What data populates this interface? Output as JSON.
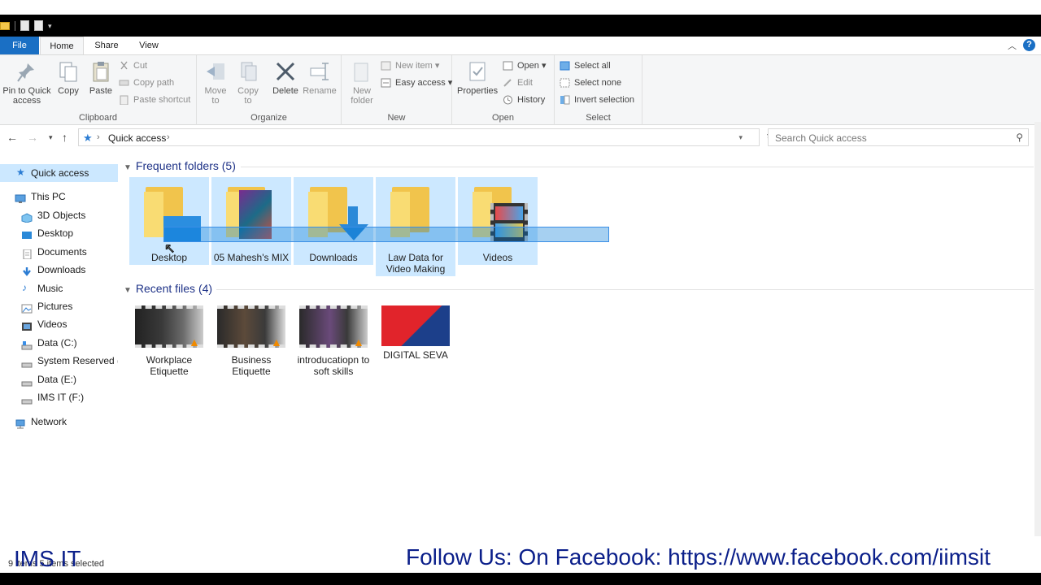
{
  "tabs": {
    "file": "File",
    "home": "Home",
    "share": "Share",
    "view": "View",
    "help": "?"
  },
  "ribbon": {
    "clipboard": {
      "label": "Clipboard",
      "pin": "Pin to Quick access",
      "copy": "Copy",
      "paste": "Paste",
      "cut": "Cut",
      "copy_path": "Copy path",
      "paste_shortcut": "Paste shortcut"
    },
    "organize": {
      "label": "Organize",
      "move_to": "Move to",
      "copy_to": "Copy to",
      "delete": "Delete",
      "rename": "Rename"
    },
    "new": {
      "label": "New",
      "new_folder": "New folder",
      "new_item": "New item",
      "easy_access": "Easy access"
    },
    "open": {
      "label": "Open",
      "properties": "Properties",
      "open": "Open",
      "edit": "Edit",
      "history": "History"
    },
    "select": {
      "label": "Select",
      "select_all": "Select all",
      "select_none": "Select none",
      "invert": "Invert selection"
    }
  },
  "address": {
    "path": "Quick access",
    "search_placeholder": "Search Quick access"
  },
  "nav": [
    {
      "label": "Quick access",
      "icon": "star-icon",
      "selected": true
    },
    {
      "label": "This PC",
      "icon": "pc-icon"
    },
    {
      "label": "3D Objects",
      "icon": "cube-icon"
    },
    {
      "label": "Desktop",
      "icon": "desktop-icon"
    },
    {
      "label": "Documents",
      "icon": "document-icon"
    },
    {
      "label": "Downloads",
      "icon": "download-icon"
    },
    {
      "label": "Music",
      "icon": "music-icon"
    },
    {
      "label": "Pictures",
      "icon": "pictures-icon"
    },
    {
      "label": "Videos",
      "icon": "videos-icon"
    },
    {
      "label": "Data (C:)",
      "icon": "drive-icon"
    },
    {
      "label": "System Reserved (D",
      "icon": "drive-icon"
    },
    {
      "label": "Data (E:)",
      "icon": "drive-icon"
    },
    {
      "label": "IMS IT (F:)",
      "icon": "drive-icon"
    },
    {
      "label": "Network",
      "icon": "network-icon"
    }
  ],
  "frequent": {
    "header": "Frequent folders (5)",
    "items": [
      {
        "label": "Desktop"
      },
      {
        "label": "05 Mahesh's MIX"
      },
      {
        "label": "Downloads"
      },
      {
        "label": "Law Data for Video Making"
      },
      {
        "label": "Videos"
      }
    ]
  },
  "recent": {
    "header": "Recent files (4)",
    "items": [
      {
        "label": "Workplace Etiquette"
      },
      {
        "label": "Business Etiquette"
      },
      {
        "label": "introducatiopn to soft skills"
      },
      {
        "label": "DIGITAL SEVA"
      }
    ]
  },
  "status": {
    "text": "9 items   5 items selected"
  },
  "overlay": {
    "left": "IMS IT",
    "right": "Follow Us: On Facebook: https://www.facebook.com/iimsit"
  },
  "colors": {
    "accent": "#1a6fc4",
    "selection": "#cce8ff",
    "folder": "#f1c44c",
    "overlay_text": "#0b1f8a"
  }
}
